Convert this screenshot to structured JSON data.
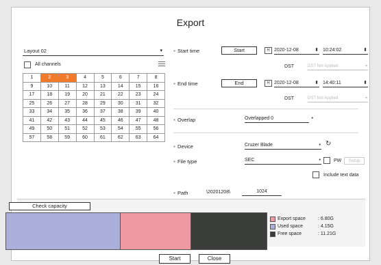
{
  "dialog": {
    "title": "Export"
  },
  "left": {
    "layout_value": "Layout 02",
    "all_channels_label": "All channels",
    "channels": [
      1,
      2,
      3,
      4,
      5,
      6,
      7,
      8,
      9,
      10,
      11,
      12,
      13,
      14,
      15,
      16,
      17,
      18,
      19,
      20,
      21,
      22,
      23,
      24,
      25,
      26,
      27,
      28,
      29,
      30,
      31,
      32,
      33,
      34,
      35,
      36,
      37,
      38,
      39,
      40,
      41,
      42,
      43,
      44,
      45,
      46,
      47,
      48,
      49,
      50,
      51,
      52,
      53,
      54,
      55,
      56,
      57,
      58,
      59,
      60,
      61,
      62,
      63,
      64
    ],
    "selected_channels": [
      2,
      3
    ],
    "icon": "list-icon"
  },
  "right": {
    "start_time_label": "Start time",
    "start_button": "Start",
    "start_date": "2020-12-08",
    "start_time": "10:24:02",
    "dst_label": "DST",
    "dst_value": "DST Not Applied",
    "end_time_label": "End time",
    "end_button": "End",
    "end_date": "2020-12-08",
    "end_time": "14:40:11",
    "overlap_label": "Overlap",
    "overlap_value": "Overlapped 0",
    "device_label": "Device",
    "device_value": "Cruzer Blade",
    "file_type_label": "File type",
    "file_type_value": "SEC",
    "pw_label": "PW",
    "setup_label": "Setup",
    "include_text_label": "Include text data",
    "path_label": "Path",
    "path_prefix": "\\20201208\\",
    "path_value": "1024",
    "h_icon_text": "H"
  },
  "capacity": {
    "check_button": "Check capacity",
    "export_fraction": 0.27,
    "used_fraction": 0.44,
    "free_fraction": 0.29,
    "legend": [
      {
        "label": "Export space",
        "value": ": 6.80G",
        "color": "#ef9aa3"
      },
      {
        "label": "Used space",
        "value": ": 4.15G",
        "color": "#aab0da"
      },
      {
        "label": "Free space",
        "value": ": 11.21G",
        "color": "#3b3d3b"
      }
    ]
  },
  "footer": {
    "start_label": "Start",
    "close_label": "Close"
  },
  "colors": {
    "selected_channel": "#f07b2c"
  }
}
